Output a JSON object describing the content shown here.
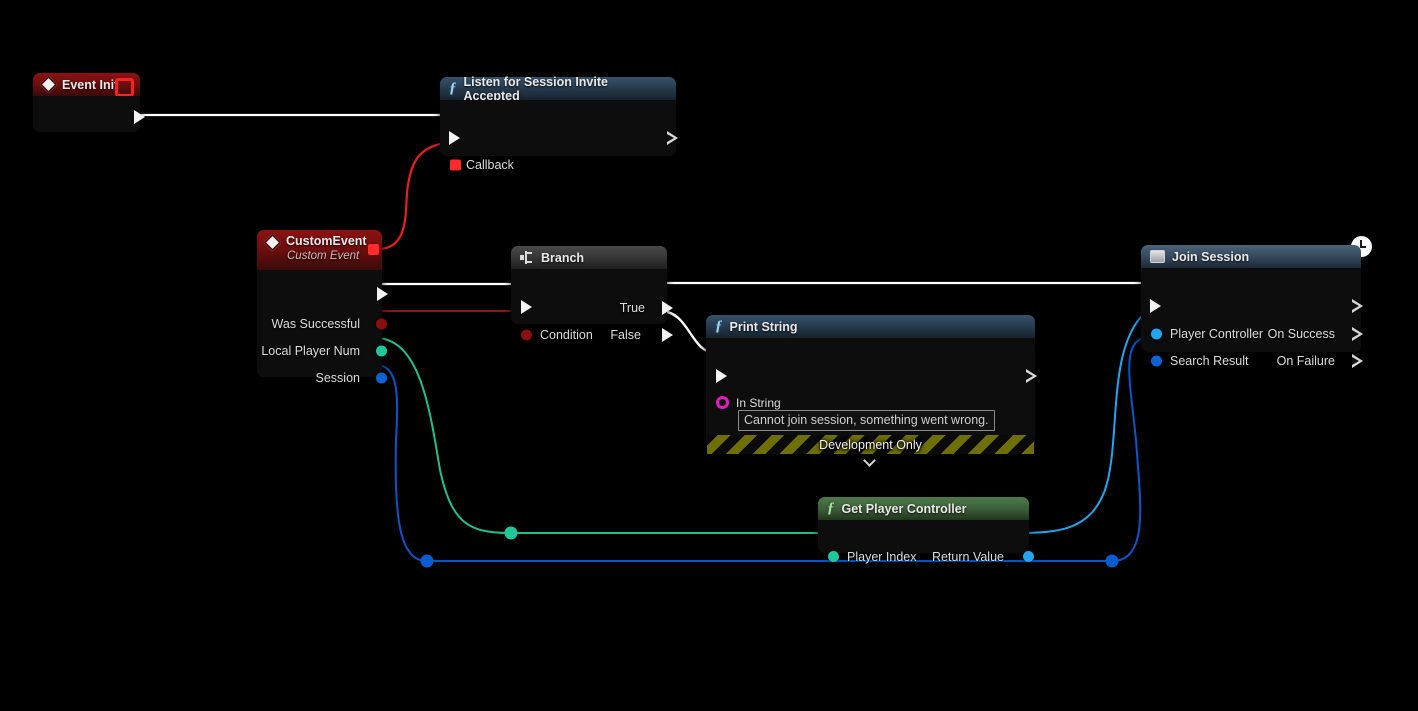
{
  "graph": {
    "background_color": "#000000",
    "wire_colors": {
      "exec": "#ffffff",
      "delegate": "#ff1f1f",
      "boolean": "#8a0f0f",
      "integer": "#21c79a",
      "object_light": "#23a6ef",
      "struct_blue": "#0b5bd3"
    }
  },
  "nodes": {
    "event_init": {
      "title": "Event Init",
      "icon": "event-diamond-icon",
      "delegate_pin": "delegate-output-pin",
      "exec_out": "exec-output-pin"
    },
    "listen_invite": {
      "title": "Listen for Session Invite Accepted",
      "icon": "function-f-icon",
      "exec_in": "exec-input-pin",
      "exec_out": "exec-output-pin",
      "inputs": [
        {
          "label": "Callback",
          "pin": "delegate-pin",
          "color": "#ff2a2a"
        }
      ]
    },
    "custom_event": {
      "title": "CustomEvent",
      "subtitle": "Custom Event",
      "icon": "event-diamond-icon",
      "delegate_pin": "delegate-output-pin",
      "outputs": [
        {
          "label": "",
          "pin": "exec-output-pin"
        },
        {
          "label": "Was Successful",
          "pin": "boolean-pin",
          "color": "#8a0f0f"
        },
        {
          "label": "Local Player Num",
          "pin": "integer-pin",
          "color": "#21c79a"
        },
        {
          "label": "Session",
          "pin": "struct-pin",
          "color": "#0b63d6"
        }
      ]
    },
    "branch": {
      "title": "Branch",
      "icon": "branch-icon",
      "inputs": [
        {
          "label": "",
          "pin": "exec-input-pin"
        },
        {
          "label": "Condition",
          "pin": "boolean-pin",
          "color": "#8a0f0f"
        }
      ],
      "outputs": [
        {
          "label": "True",
          "pin": "exec-output-pin"
        },
        {
          "label": "False",
          "pin": "exec-output-pin"
        }
      ]
    },
    "print_string": {
      "title": "Print String",
      "icon": "function-f-icon",
      "exec_in": "exec-input-pin",
      "exec_out": "exec-output-pin",
      "in_string_label": "In String",
      "in_string_value": "Cannot join session, something went wrong.",
      "dev_only_label": "Development Only",
      "expander": "chevron-down-icon"
    },
    "get_player_controller": {
      "title": "Get Player Controller",
      "icon": "function-f-icon",
      "inputs": [
        {
          "label": "Player Index",
          "pin": "integer-pin",
          "color": "#21c79a"
        }
      ],
      "outputs": [
        {
          "label": "Return Value",
          "pin": "object-pin",
          "color": "#23a6ef"
        }
      ]
    },
    "join_session": {
      "title": "Join Session",
      "icon": "node-square-icon",
      "latent_badge": "clock-icon",
      "exec_in": "exec-input-pin",
      "exec_out": "exec-output-pin",
      "inputs": [
        {
          "label": "Player Controller",
          "pin": "object-pin",
          "color": "#23a6ef"
        },
        {
          "label": "Search Result",
          "pin": "struct-pin",
          "color": "#0b63d6"
        }
      ],
      "outputs": [
        {
          "label": "On Success",
          "pin": "exec-output-pin"
        },
        {
          "label": "On Failure",
          "pin": "exec-output-pin"
        }
      ]
    }
  }
}
